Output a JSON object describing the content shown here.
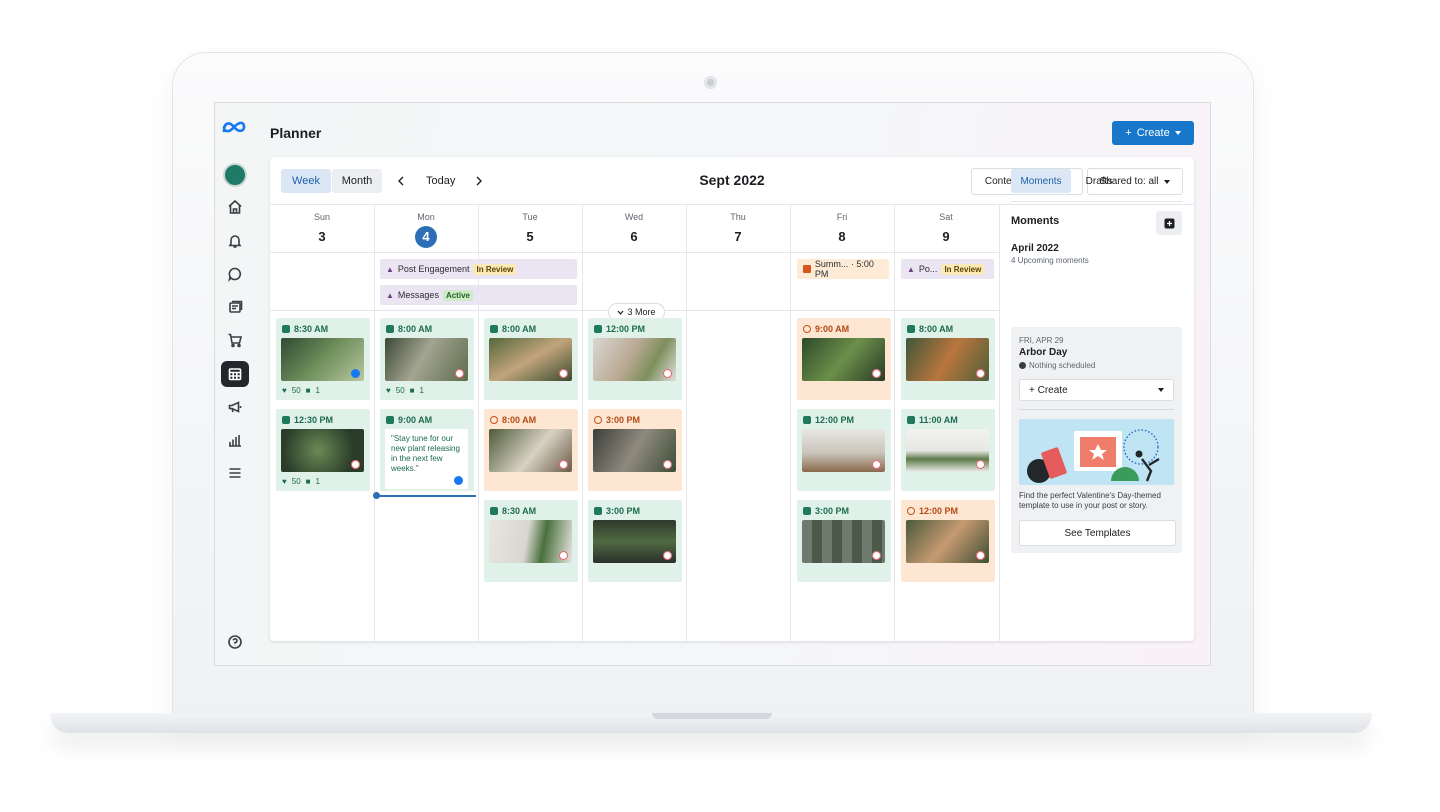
{
  "app": {
    "title": "Planner",
    "create_label": "Create"
  },
  "toolbar": {
    "week_label": "Week",
    "month_label": "Month",
    "today_label": "Today",
    "month_title": "Sept 2022",
    "content_type_label": "Content type: all",
    "shared_to_label": "Shared to: all"
  },
  "days": [
    {
      "name": "Sun",
      "date": "3"
    },
    {
      "name": "Mon",
      "date": "4",
      "today": true
    },
    {
      "name": "Tue",
      "date": "5"
    },
    {
      "name": "Wed",
      "date": "6"
    },
    {
      "name": "Thu",
      "date": "7"
    },
    {
      "name": "Fri",
      "date": "8"
    },
    {
      "name": "Sat",
      "date": "9"
    }
  ],
  "banners": {
    "post_engagement": {
      "label": "Post Engagement",
      "status": "In Review"
    },
    "messages": {
      "label": "Messages",
      "status": "Active"
    },
    "summer": {
      "label": "Summ... · 5:00 PM"
    },
    "po": {
      "label": "Po...",
      "status": "In Review"
    }
  },
  "more_label": "3 More",
  "cards": {
    "sun1": {
      "time": "8:30 AM",
      "likes": "50",
      "comments": "1"
    },
    "sun2": {
      "time": "12:30 PM",
      "likes": "50",
      "comments": "1"
    },
    "mon1": {
      "time": "8:00 AM",
      "likes": "50",
      "comments": "1"
    },
    "mon2": {
      "time": "9:00 AM",
      "quote": "\"Stay tune for our new plant releasing in the next few weeks.\""
    },
    "tue1": {
      "time": "8:00 AM"
    },
    "tue2": {
      "time": "8:00 AM"
    },
    "tue3": {
      "time": "8:30 AM"
    },
    "wed1": {
      "time": "12:00 PM"
    },
    "wed2": {
      "time": "3:00 PM"
    },
    "wed3": {
      "time": "3:00 PM"
    },
    "fri1": {
      "time": "9:00 AM"
    },
    "fri2": {
      "time": "12:00 PM"
    },
    "fri3": {
      "time": "3:00 PM"
    },
    "sat1": {
      "time": "8:00 AM"
    },
    "sat2": {
      "time": "11:00 AM"
    },
    "sat3": {
      "time": "12:00 PM"
    }
  },
  "right_panel": {
    "tab_moments": "Moments",
    "tab_drafts": "Drafts",
    "heading": "Moments",
    "month": "April 2022",
    "upcoming": "4 Upcoming moments",
    "moment": {
      "date": "FRI, APR 29",
      "title": "Arbor Day",
      "status": "Nothing scheduled",
      "create_label": "Create",
      "promo_text": "Find the perfect Valentine's Day-themed template to use in your post or story.",
      "see_templates": "See Templates"
    }
  },
  "colors": {
    "accent": "#1877c9",
    "post_green": "#e0f1ea",
    "post_orange": "#fde6d2",
    "banner_purple": "#ebe4f2"
  }
}
